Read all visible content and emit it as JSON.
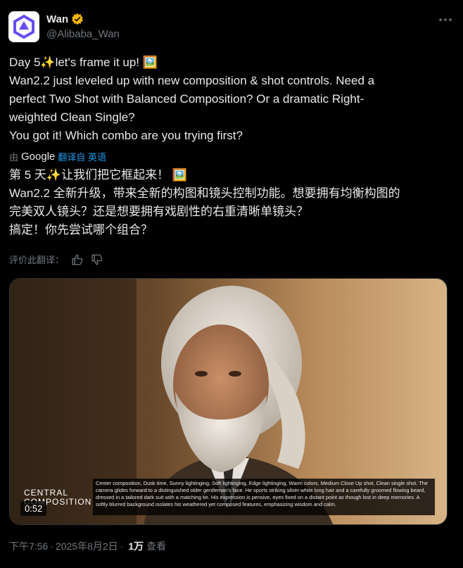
{
  "header": {
    "display_name": "Wan",
    "handle": "@Alibaba_Wan",
    "verified_icon": "verified-badge-icon",
    "more_icon": "more-horizontal-icon"
  },
  "tweet": {
    "lines": [
      "Day 5✨let's frame it up! 🖼️",
      "Wan2.2 just leveled up with new composition & shot controls. Need a",
      "perfect Two Shot with Balanced Composition? Or a dramatic Right-",
      "weighted Clean Single?",
      "You got it! Which combo are you trying first?"
    ]
  },
  "translation_notice": {
    "by": "由",
    "google": "Google",
    "link": "翻译自 英语"
  },
  "translation": {
    "lines": [
      "第 5 天✨让我们把它框起来！ 🖼️",
      "Wan2.2 全新升级，带来全新的构图和镜头控制功能。想要拥有均衡构图的",
      "完美双人镜头？还是想要拥有戏剧性的右重清晰单镜头？",
      "搞定！你先尝试哪个组合？"
    ]
  },
  "rating": {
    "label": "评价此翻译：",
    "thumbs_up_icon": "thumbs-up-icon",
    "thumbs_down_icon": "thumbs-down-icon"
  },
  "media": {
    "overlay_title_line1": "CENTRAL",
    "overlay_title_line2": "COMPOSITION",
    "duration": "0:52",
    "caption": "Center composition, Dusk time, Sunny lightinging, Soft lightinging, Edge lightinging, Warm colors, Medium Close Up shot, Clean single shot. The camera glides forward to a distinguished older gentleman's face. He sports striking silver-white long hair and a carefully groomed flowing beard, dressed in a tailored dark suit with a matching tie. His expression is pensive, eyes fixed on a distant point as though lost in deep memories. A softly blurred background isolates his weathered yet composed features, emphasizing wisdom and calm."
  },
  "footer": {
    "time": "下午7:56",
    "sep1": "·",
    "date": "2025年8月2日",
    "sep2": "·",
    "views": "1万",
    "views_label": "查看"
  },
  "colors": {
    "background": "#000000",
    "text": "#e7e9ea",
    "muted": "#71767b",
    "link": "#1d9bf0",
    "verified": "#f4b400"
  }
}
